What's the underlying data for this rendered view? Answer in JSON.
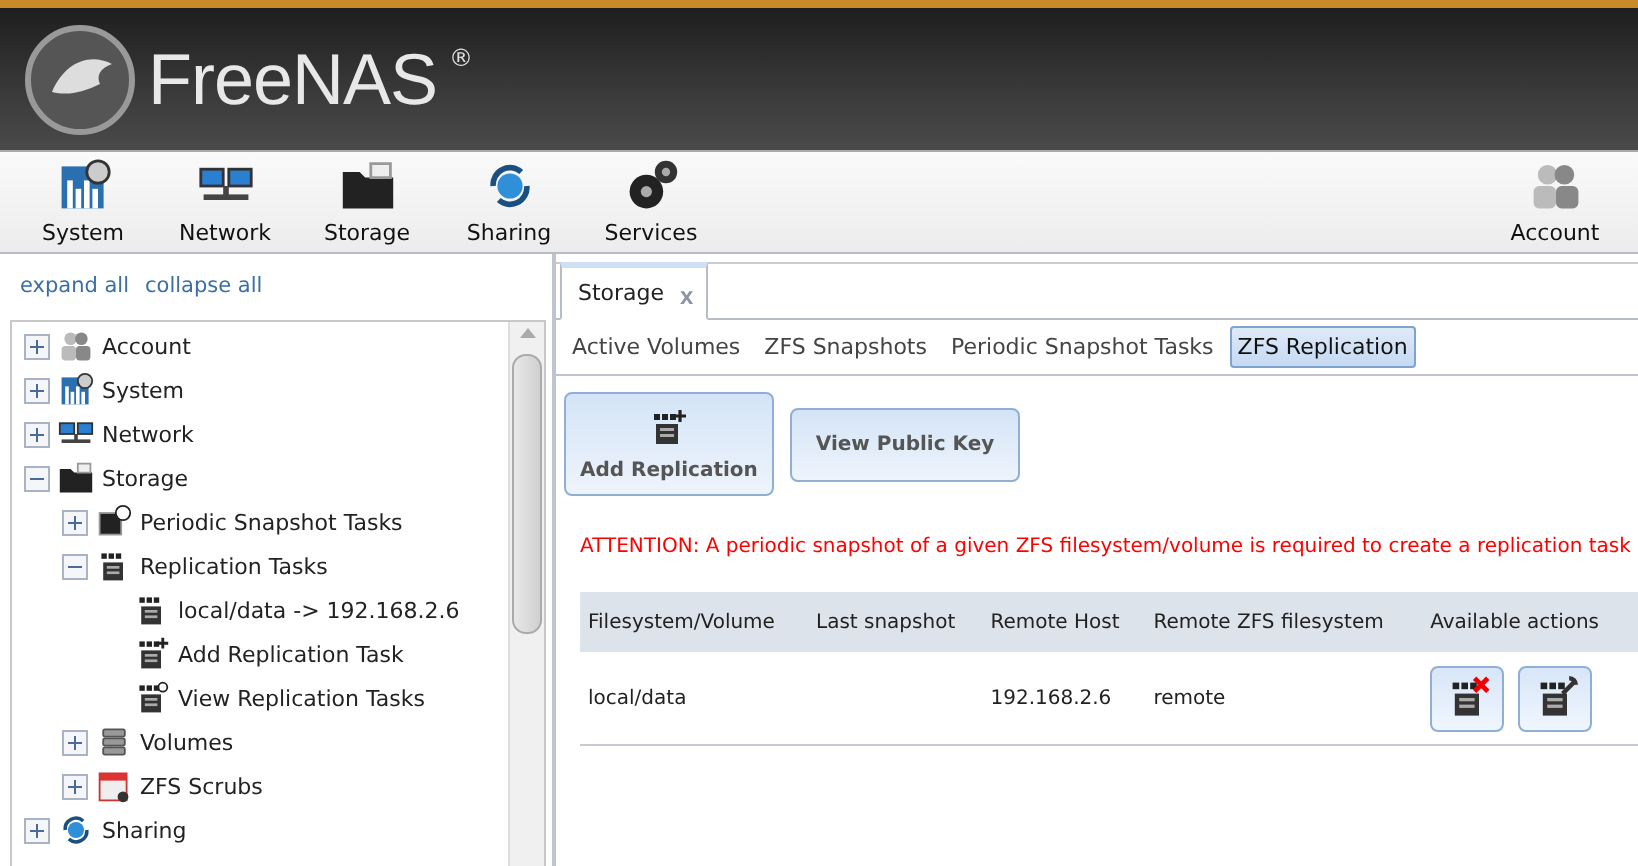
{
  "brand": {
    "name": "FreeNAS",
    "mark": "®"
  },
  "toolbar": {
    "items": [
      {
        "label": "System"
      },
      {
        "label": "Network"
      },
      {
        "label": "Storage"
      },
      {
        "label": "Sharing"
      },
      {
        "label": "Services"
      }
    ],
    "account": {
      "label": "Account"
    }
  },
  "sidebar": {
    "links": [
      "expand all",
      "collapse all"
    ],
    "tree": [
      {
        "label": "Account",
        "expanded": false
      },
      {
        "label": "System",
        "expanded": false
      },
      {
        "label": "Network",
        "expanded": false
      },
      {
        "label": "Storage",
        "expanded": true,
        "children": [
          {
            "label": "Periodic Snapshot Tasks",
            "expanded": false
          },
          {
            "label": "Replication Tasks",
            "expanded": true,
            "children": [
              {
                "label": "local/data -> 192.168.2.6"
              },
              {
                "label": "Add Replication Task"
              },
              {
                "label": "View Replication Tasks"
              }
            ]
          },
          {
            "label": "Volumes",
            "expanded": false
          },
          {
            "label": "ZFS Scrubs",
            "expanded": false
          }
        ]
      },
      {
        "label": "Sharing",
        "expanded": false
      }
    ]
  },
  "tab": {
    "label": "Storage",
    "close": "x"
  },
  "subtabs": [
    {
      "label": "Active Volumes",
      "selected": false
    },
    {
      "label": "ZFS Snapshots",
      "selected": false
    },
    {
      "label": "Periodic Snapshot Tasks",
      "selected": false
    },
    {
      "label": "ZFS Replication",
      "selected": true
    }
  ],
  "buttons": [
    {
      "label": "Add Replication",
      "kind": "icon"
    },
    {
      "label": "View Public Key",
      "kind": "plain"
    }
  ],
  "attention": "ATTENTION: A periodic snapshot of a given ZFS filesystem/volume is required to create a replication task",
  "table": {
    "columns": [
      "Filesystem/Volume",
      "Last snapshot",
      "Remote Host",
      "Remote ZFS filesystem",
      "Available actions"
    ],
    "rows": [
      {
        "cells": [
          "local/data",
          "",
          "192.168.2.6",
          "remote"
        ],
        "actions": [
          {
            "kind": "delete"
          },
          {
            "kind": "edit"
          }
        ]
      }
    ]
  }
}
